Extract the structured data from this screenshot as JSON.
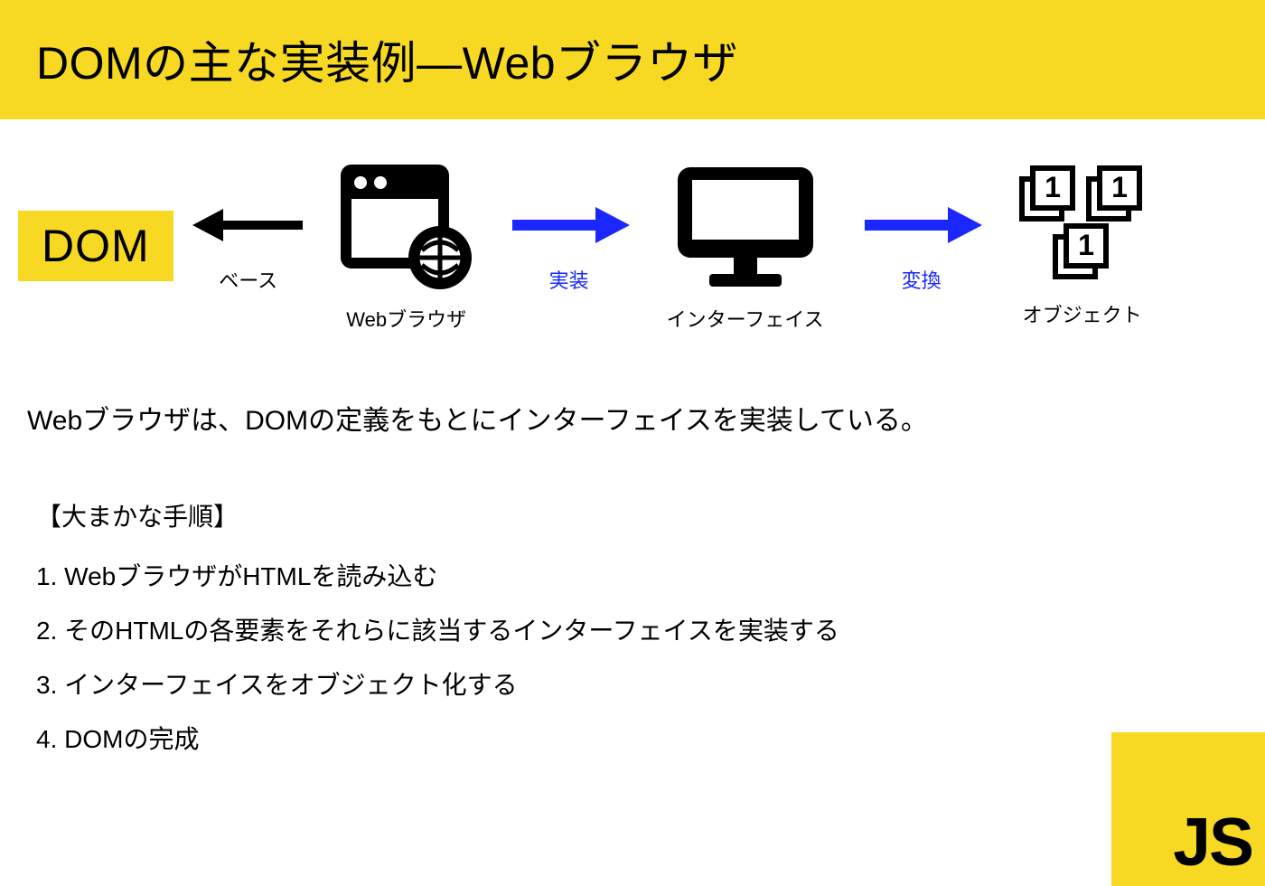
{
  "title": "DOMの主な実装例—Webブラウザ",
  "diagram": {
    "dom_label": "DOM",
    "arrow1_label": "ベース",
    "browser_label": "Webブラウザ",
    "arrow2_label": "実装",
    "interface_label": "インターフェイス",
    "arrow3_label": "変換",
    "object_label": "オブジェクト"
  },
  "description": "Webブラウザは、DOMの定義をもとにインターフェイスを実装している。",
  "steps_title": "【大まかな手順】",
  "steps": [
    "WebブラウザがHTMLを読み込む",
    "そのHTMLの各要素をそれらに該当するインターフェイスを実装する",
    "インターフェイスをオブジェクト化する",
    "DOMの完成"
  ],
  "badge": "JS",
  "colors": {
    "accent": "#f7d924",
    "arrow_black": "#000000",
    "arrow_blue": "#1a28ff"
  }
}
